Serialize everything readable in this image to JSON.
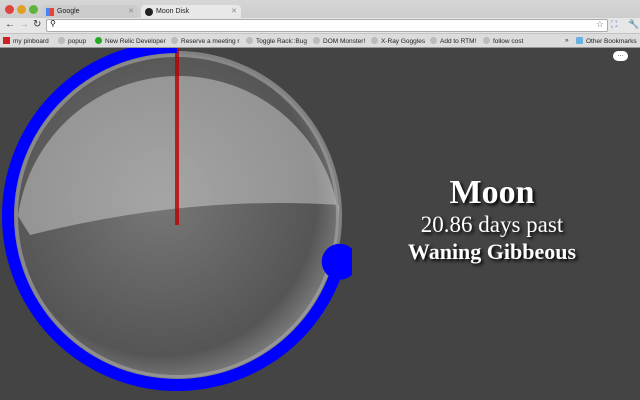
{
  "browser": {
    "tabs": [
      {
        "label": "Google",
        "icon": "google-icon"
      },
      {
        "label": "Moon Disk",
        "icon": "moon-icon",
        "active": true
      }
    ],
    "address": "",
    "bookmarks": [
      "my pinboard",
      "popup",
      "New Relic Developer",
      "Reserve a meeting r",
      "Toggle Rack::Bug",
      "DOM Monster!",
      "X-Ray Goggles",
      "Add to RTM!",
      "follow cost"
    ],
    "overflow": "»",
    "other_bookmarks": "Other Bookmarks"
  },
  "moon": {
    "title": "Moon",
    "days": "20.86 days past",
    "phase": "Waning Gibbeous",
    "age_days": 20.86,
    "accent": "#0000ff"
  },
  "bubble": "..."
}
